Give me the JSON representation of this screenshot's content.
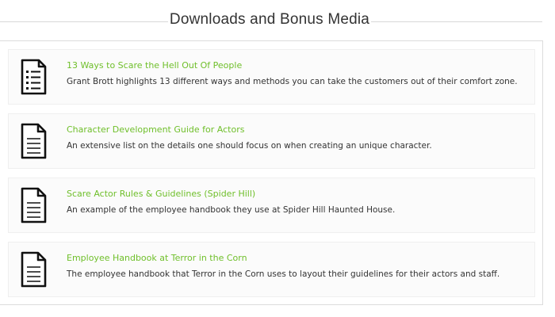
{
  "section": {
    "title": "Downloads and Bonus Media"
  },
  "downloads": [
    {
      "icon": "list-document-icon",
      "title": "13 Ways to Scare the Hell Out Of People",
      "description": "Grant Brott highlights 13 different ways and methods you can take the customers out of their comfort zone."
    },
    {
      "icon": "document-icon",
      "title": "Character Development Guide for Actors",
      "description": "An extensive list on the details one should focus on when creating an unique character."
    },
    {
      "icon": "document-icon",
      "title": "Scare Actor Rules & Guidelines (Spider Hill)",
      "description": "An example of the employee handbook they use at Spider Hill Haunted House."
    },
    {
      "icon": "document-icon",
      "title": "Employee Handbook at Terror in the Corn",
      "description": "The employee handbook that Terror in the Corn uses to layout their guidelines for their actors and staff."
    }
  ],
  "colors": {
    "link_green": "#6fbf2a",
    "text_dark": "#333333",
    "card_background": "#fbfbfb"
  }
}
